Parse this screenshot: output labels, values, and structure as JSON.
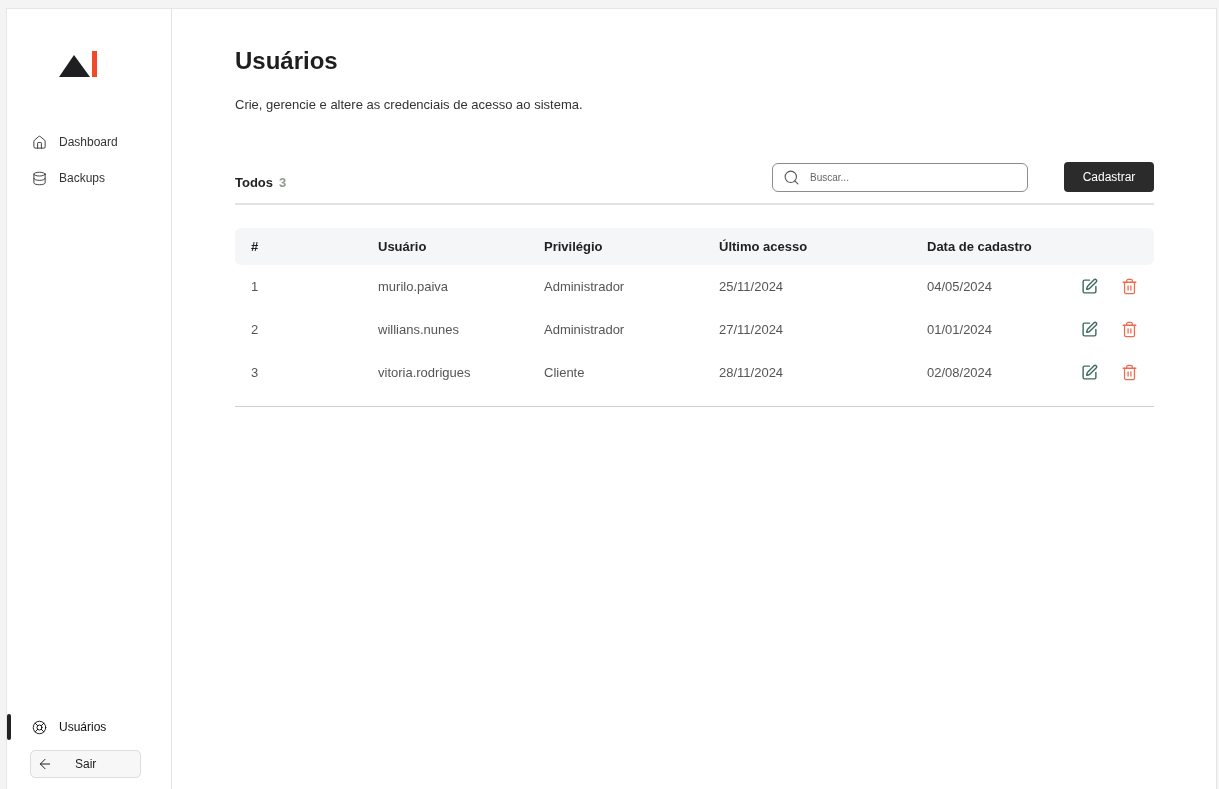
{
  "sidebar": {
    "nav": [
      {
        "label": "Dashboard",
        "selected": false
      },
      {
        "label": "Backups",
        "selected": false
      }
    ],
    "bottom_nav": [
      {
        "label": "Usuários",
        "selected": true
      }
    ],
    "logout": {
      "label": "Sair"
    }
  },
  "page": {
    "title": "Usuários",
    "subtitle": "Crie, gerencie e altere as credenciais de acesso ao sistema."
  },
  "toolbar": {
    "filter": {
      "label": "Todos",
      "count": "3"
    },
    "search": {
      "placeholder": "Buscar..."
    },
    "primary_button": "Cadastrar"
  },
  "table": {
    "columns": [
      "#",
      "Usuário",
      "Privilégio",
      "Último acesso",
      "Data de cadastro"
    ],
    "rows": [
      {
        "cells": [
          "1",
          "murilo.paiva",
          "Administrador",
          "25/11/2024",
          "04/05/2024"
        ]
      },
      {
        "cells": [
          "2",
          "willians.nunes",
          "Administrador",
          "27/11/2024",
          "01/01/2024"
        ]
      },
      {
        "cells": [
          "3",
          "vitoria.rodrigues",
          "Cliente",
          "28/11/2024",
          "02/08/2024"
        ]
      }
    ]
  }
}
